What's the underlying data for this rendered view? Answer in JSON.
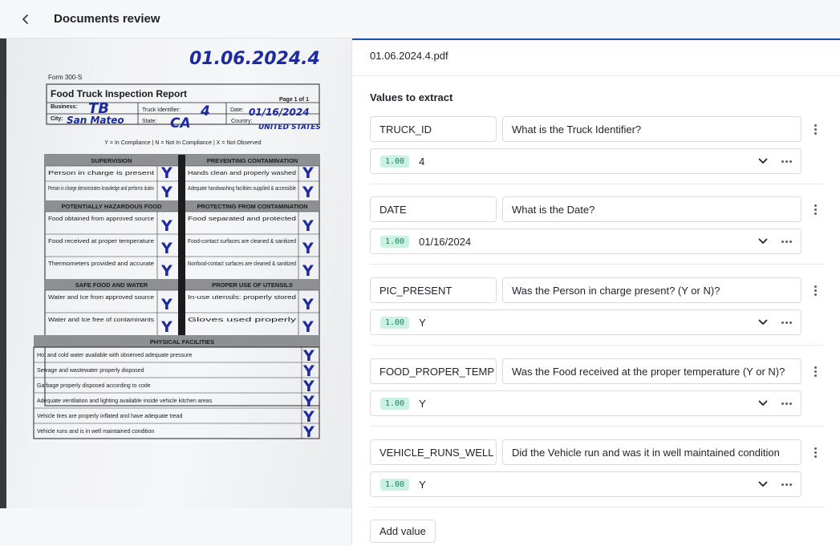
{
  "header": {
    "title": "Documents review"
  },
  "document": {
    "file_name": "01.06.2024.4.pdf",
    "top_note": "01.06.2024.4",
    "form_code": "Form 300-S",
    "form_title": "Food Truck Inspection Report",
    "page_label": "Page 1 of 1",
    "fields": {
      "business_label": "Business:",
      "business_value": "TB",
      "truck_label": "Truck Identifier:",
      "truck_value": "4",
      "date_label": "Date:",
      "date_value": "01/16/2024",
      "city_label": "City:",
      "city_value": "San Mateo",
      "state_label": "State:",
      "state_value": "CA",
      "country_label": "Country:",
      "country_value": "UNITED STATES"
    },
    "legend": "Y = In Compliance  |  N = Not In Compliance  |  X = Not Observed",
    "mark": "Y",
    "grid": [
      {
        "left_header": "SUPERVISION",
        "right_header": "PREVENTING CONTAMINATION",
        "rows": [
          {
            "left": "Person in charge is present",
            "right": "Hands clean and properly washed"
          },
          {
            "left": "Person in charge demonstrates knowledge and performs duties",
            "right": "Adequate handwashing facilities supplied & accessible"
          }
        ]
      },
      {
        "left_header": "POTENTIALLY HAZARDOUS FOOD",
        "right_header": "PROTECTING FROM CONTAMINATION",
        "rows": [
          {
            "left": "Food obtained from approved source",
            "right": "Food separated and protected"
          },
          {
            "left": "Food received at proper temperature",
            "right": "Food-contact surfaces are cleaned & sanitized"
          },
          {
            "left": "Thermometers provided and accurate",
            "right": "Nonfood-contact surfaces are cleaned & sanitized"
          }
        ]
      },
      {
        "left_header": "SAFE FOOD AND WATER",
        "right_header": "PROPER USE OF UTENSILS",
        "rows": [
          {
            "left": "Water and Ice from approved source",
            "right": "In-use utensils: properly stored"
          },
          {
            "left": "Water and Ice free of contaminants",
            "right": "Gloves used properly"
          }
        ]
      }
    ],
    "physical_header": "PHYSICAL FACILITIES",
    "physical_rows": [
      "Hot and cold water available with observed adequate pressure",
      "Sewage and wastewater properly disposed",
      "Garbage properly disposed according to code",
      "Adequate ventilation and lighting available inside vehicle kitchen areas",
      "Vehicle tires are properly inflated and have adequate tread",
      "Vehicle runs and is in well maintained condition"
    ]
  },
  "extraction": {
    "section_label": "Values to extract",
    "add_label": "Add value",
    "rows": [
      {
        "name": "TRUCK_ID",
        "question": "What is the Truck Identifier?",
        "confidence": "1.00",
        "value": "4"
      },
      {
        "name": "DATE",
        "question": "What is the Date?",
        "confidence": "1.00",
        "value": "01/16/2024"
      },
      {
        "name": "PIC_PRESENT",
        "question": "Was the Person in charge present? (Y or N)?",
        "confidence": "1.00",
        "value": "Y"
      },
      {
        "name": "FOOD_PROPER_TEMP",
        "question": "Was the Food received at the proper temperature (Y or N)?",
        "confidence": "1.00",
        "value": "Y"
      },
      {
        "name": "VEHICLE_RUNS_WELL",
        "question": "Did the Vehicle run and was it in well maintained condition",
        "confidence": "1.00",
        "value": "Y"
      }
    ]
  }
}
